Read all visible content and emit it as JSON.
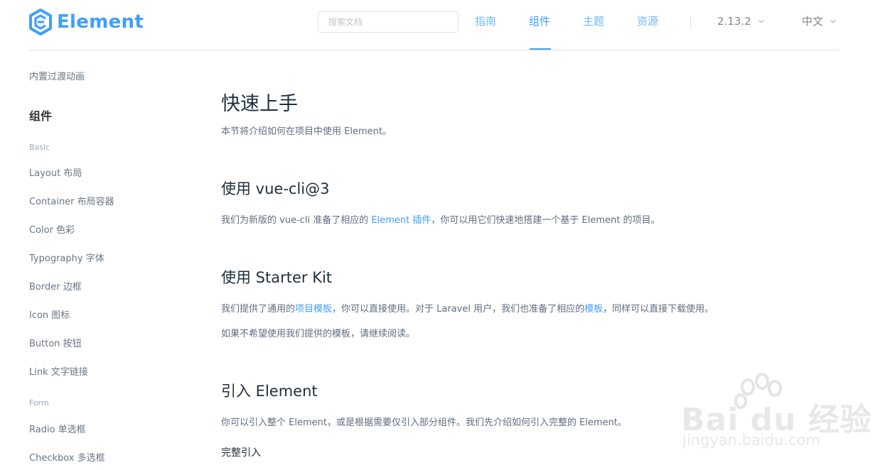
{
  "header": {
    "logo_text": "Element",
    "search_placeholder": "搜索文档",
    "nav": [
      "指南",
      "组件",
      "主题",
      "资源"
    ],
    "active_nav": "组件",
    "version": "2.13.2",
    "language": "中文"
  },
  "sidebar": {
    "top_item": "内置过渡动画",
    "group_title": "组件",
    "categories": [
      "Basic",
      "Form"
    ],
    "basic_items": [
      "Layout 布局",
      "Container 布局容器",
      "Color 色彩",
      "Typography 字体",
      "Border 边框",
      "Icon 图标",
      "Button 按钮",
      "Link 文字链接"
    ],
    "form_items": [
      "Radio 单选框",
      "Checkbox 多选框"
    ]
  },
  "main": {
    "title": "快速上手",
    "intro": "本节将介绍如何在项目中使用 Element。",
    "sec1": {
      "title": "使用 vue-cli@3",
      "p_before": "我们为新版的 vue-cli 准备了相应的 ",
      "link": "Element 插件",
      "p_after": "，你可以用它们快速地搭建一个基于 Element 的项目。"
    },
    "sec2": {
      "title": "使用 Starter Kit",
      "p1_before": "我们提供了通用的",
      "link1": "项目模板",
      "p1_mid": "，你可以直接使用。对于 Laravel 用户，我们也准备了相应的",
      "link2": "模板",
      "p1_after": "，同样可以直接下载使用。",
      "p2": "如果不希望使用我们提供的模板，请继续阅读。"
    },
    "sec3": {
      "title": "引入 Element",
      "p": "你可以引入整个 Element，或是根据需要仅引入部分组件。我们先介绍如何引入完整的 Element。",
      "sub": "完整引入"
    }
  },
  "watermark": {
    "text": "Bai du 经验",
    "url_text": "jingyan.baidu.com"
  },
  "colors": {
    "accent": "#409eff",
    "text": "#1f2f3d",
    "muted": "#5e6d82",
    "border": "#dcdfe6"
  }
}
